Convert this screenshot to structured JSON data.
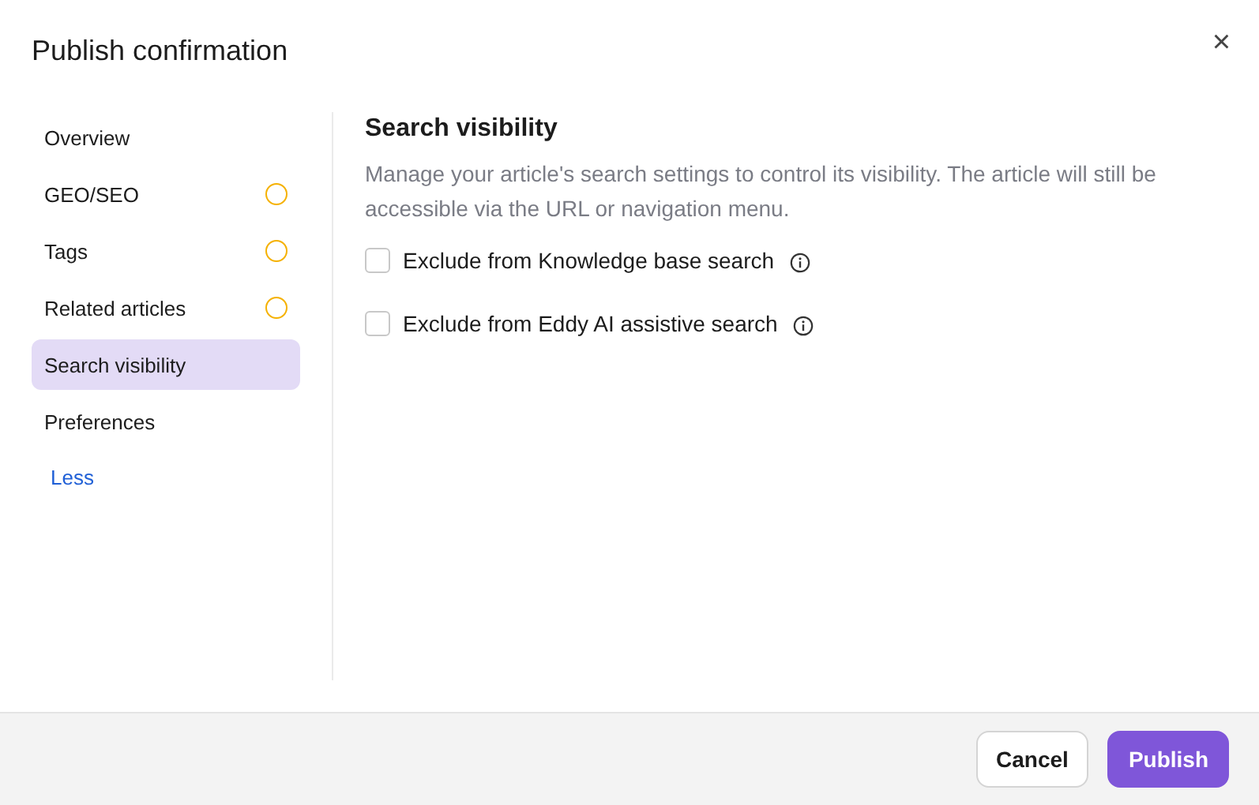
{
  "dialog": {
    "title": "Publish confirmation",
    "close": "×"
  },
  "sidebar": {
    "items": [
      {
        "label": "Overview",
        "selected": false,
        "pending": false
      },
      {
        "label": "GEO/SEO",
        "selected": false,
        "pending": true
      },
      {
        "label": "Tags",
        "selected": false,
        "pending": true
      },
      {
        "label": "Related articles",
        "selected": false,
        "pending": true
      },
      {
        "label": "Search visibility",
        "selected": true,
        "pending": false
      },
      {
        "label": "Preferences",
        "selected": false,
        "pending": false
      }
    ],
    "toggle_link": "Less"
  },
  "section": {
    "heading": "Search visibility",
    "description": "Manage your article's search settings to control its visibility. The article will still be accessible via the URL or navigation menu.",
    "options": [
      {
        "label": "Exclude from Knowledge base search",
        "checked": false
      },
      {
        "label": "Exclude from Eddy AI assistive search",
        "checked": false
      }
    ]
  },
  "buttons": [
    {
      "label": "Cancel",
      "kind": "secondary"
    },
    {
      "label": "Publish",
      "kind": "primary"
    }
  ]
}
